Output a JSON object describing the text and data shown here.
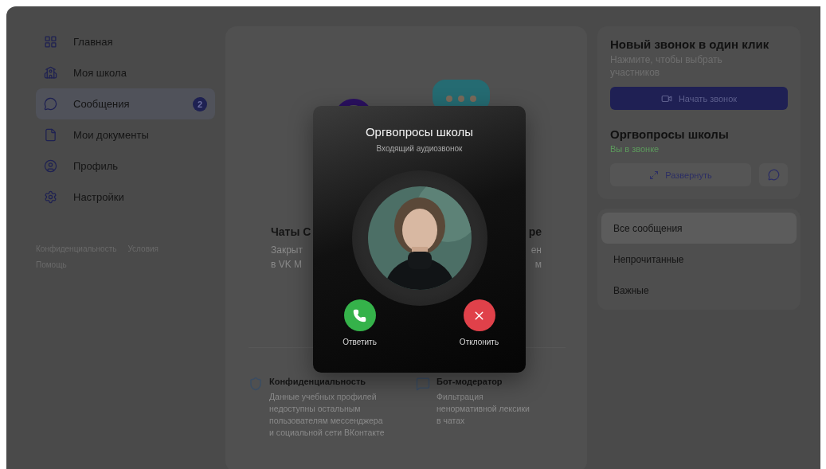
{
  "sidebar": {
    "items": [
      {
        "label": "Главная",
        "selected": false
      },
      {
        "label": "Моя школа",
        "selected": false
      },
      {
        "label": "Сообщения",
        "selected": true,
        "badge": "2"
      },
      {
        "label": "Мои документы",
        "selected": false
      },
      {
        "label": "Профиль",
        "selected": false
      },
      {
        "label": "Настройки",
        "selected": false
      }
    ],
    "links": [
      "Конфиденциальность",
      "Условия",
      "Помощь"
    ]
  },
  "promo": {
    "heading_left": "Чаты С",
    "heading_right": "ре",
    "text_left": [
      "Закрыт",
      "в VK М"
    ],
    "text_right": [
      "ен",
      "м"
    ]
  },
  "features": [
    {
      "title": "Конфиденциальность",
      "text": "Данные учебных профилей недоступны остальным пользователям мессенджера и социальной сети ВКонтакте"
    },
    {
      "title": "Бот-модератор",
      "text": "Фильтрация ненормативной лексики в чатах"
    }
  ],
  "new_call": {
    "title": "Новый звонок в один клик",
    "subtitle": "Нажмите, чтобы выбрать участников",
    "button": "Начать звонок"
  },
  "active_call": {
    "title": "Оргвопросы школы",
    "status": "Вы в звонке",
    "expand_button": "Развернуть"
  },
  "filters": [
    {
      "label": "Все сообщения",
      "selected": true
    },
    {
      "label": "Непрочитанные",
      "selected": false
    },
    {
      "label": "Важные",
      "selected": false
    }
  ],
  "incoming_call": {
    "title": "Оргвопросы школы",
    "subtitle": "Входящий аудиозвонок",
    "actions": [
      {
        "kind": "accept",
        "label": "Ответить"
      },
      {
        "kind": "decline",
        "label": "Отклонить"
      }
    ]
  }
}
